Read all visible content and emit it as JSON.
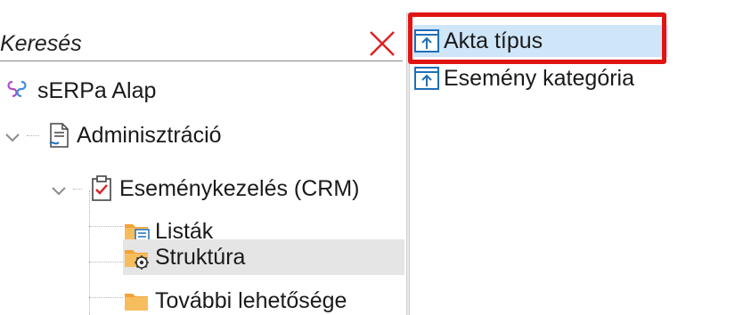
{
  "search": {
    "placeholder": "Keresés",
    "clear_icon": "close-x-icon",
    "clear_color": "#e02020"
  },
  "tree": {
    "root": {
      "label": "sERPa Alap",
      "icon": "app-logo-icon"
    },
    "administration": {
      "label": "Adminisztráció",
      "icon": "document-icon"
    },
    "crm": {
      "label": "Eseménykezelés (CRM)",
      "icon": "clipboard-check-icon"
    },
    "lists": {
      "label": "Listák",
      "icon": "folder-list-icon"
    },
    "structure": {
      "label": "Struktúra",
      "icon": "folder-gear-icon",
      "selected": true
    },
    "more": {
      "label": "További lehetősége",
      "icon": "folder-icon"
    }
  },
  "right_list": {
    "items": [
      {
        "label": "Akta típus",
        "icon": "upload-arrow-icon",
        "selected": true,
        "highlighted": true
      },
      {
        "label": "Esemény kategória",
        "icon": "upload-arrow-icon",
        "selected": false,
        "highlighted": false
      }
    ]
  },
  "colors": {
    "selection_blue": "#cfe5f8",
    "selection_gray": "#e5e5e5",
    "highlight_red": "#e11414",
    "folder_orange": "#f2a33a",
    "icon_blue": "#1f6fb8"
  }
}
